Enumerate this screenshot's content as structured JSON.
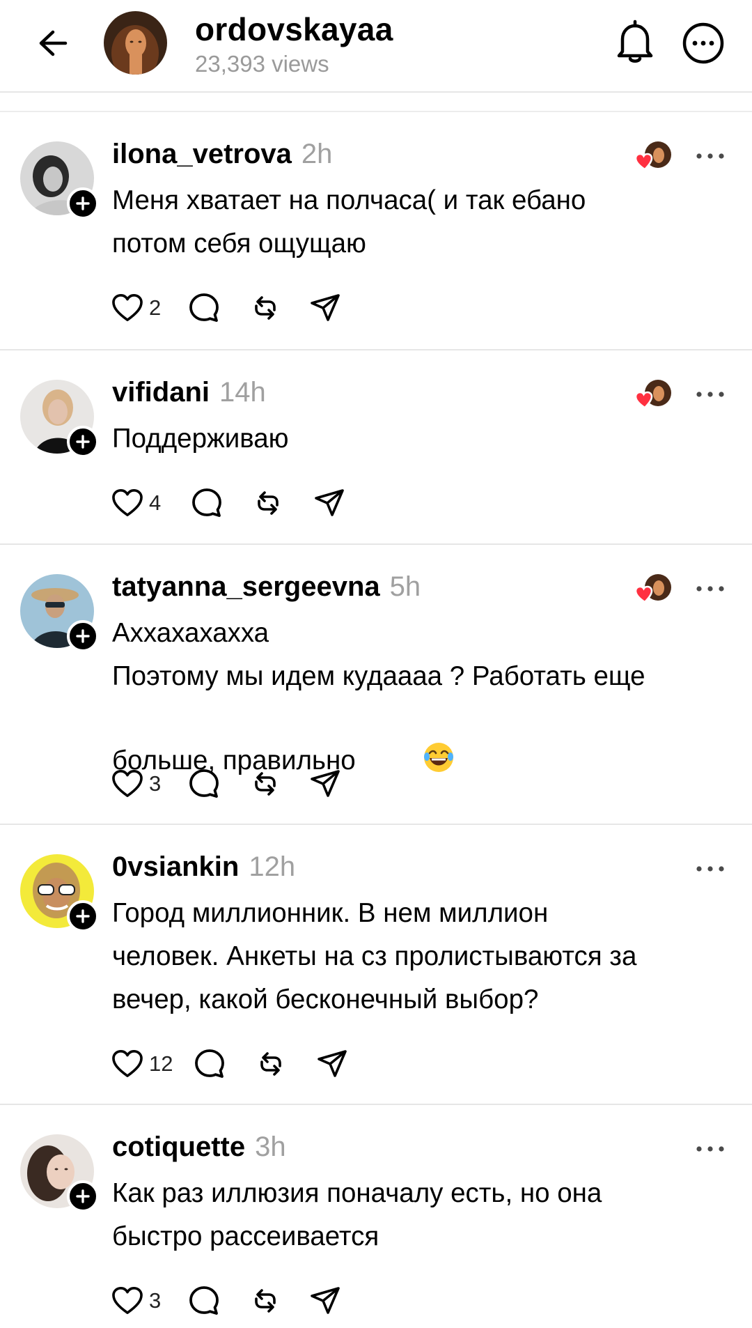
{
  "header": {
    "username": "ordovskayaa",
    "views": "23,393 views",
    "avatar_colors": {
      "bg": "#2c1a12",
      "hair": "#6b3a1d",
      "skin": "#d9915c"
    }
  },
  "comments": [
    {
      "username": "ilona_vetrova",
      "time": "2h",
      "lines": "Меня хватает на полчаса( и так ебано\nпотом себя ощущаю",
      "likes": "2",
      "liked_by_author": true,
      "avatar": {
        "bg": "#d8d8d8",
        "fg": "#2a2a2a",
        "skin": "#c7c7c7"
      }
    },
    {
      "username": "vifidani",
      "time": "14h",
      "lines": "Поддерживаю",
      "likes": "4",
      "liked_by_author": true,
      "avatar": {
        "bg": "#e8e6e4",
        "fg": "#111111",
        "skin": "#e2c2ad"
      }
    },
    {
      "username": "tatyanna_sergeevna",
      "time": "5h",
      "lines": "Аххахахахха\nПоэтому мы идем кудаааа ? Работать еще\nбольше, правильно",
      "emoji": "😂",
      "likes": "3",
      "liked_by_author": true,
      "avatar": {
        "bg": "#9fc3d8",
        "fg": "#1e2a33",
        "skin": "#c9a07e"
      }
    },
    {
      "username": "0vsiankin",
      "time": "12h",
      "lines": "Город миллионник. В нем миллион\nчеловек. Анкеты на сз пролистываются за\nвечер, какой бесконечный выбор?",
      "likes": "12",
      "liked_by_author": false,
      "avatar": {
        "bg": "#f3ea3a",
        "fg": "#4a2d14",
        "skin": "#c88e5f"
      }
    },
    {
      "username": "cotiquette",
      "time": "3h",
      "lines": "Как раз иллюзия поначалу есть, но она\nбыстро рассеивается",
      "likes": "3",
      "liked_by_author": false,
      "avatar": {
        "bg": "#e9e4e0",
        "fg": "#3a2a22",
        "skin": "#ecd0c0"
      }
    }
  ],
  "colors": {
    "accent_heart": "#ff3040",
    "muted": "#9a9a9a",
    "divider": "#e6e6e6"
  },
  "icons": {
    "back": "arrow-left-icon",
    "bell": "bell-icon",
    "more": "more-circle-icon",
    "like": "heart-icon",
    "reply": "comment-icon",
    "repost": "repost-icon",
    "share": "send-icon"
  }
}
